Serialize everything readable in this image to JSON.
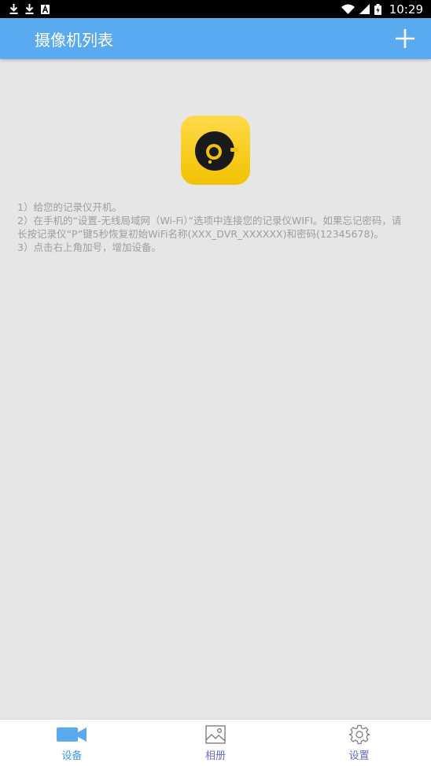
{
  "status_bar": {
    "time": "10:29",
    "icons": [
      "download-icon",
      "download-icon",
      "notification-a-icon",
      "wifi-icon",
      "signal-icon",
      "battery-icon"
    ]
  },
  "app_bar": {
    "title": "摄像机列表",
    "add_icon": "plus-icon"
  },
  "content": {
    "logo_icon": "camera-lens-logo",
    "instructions": [
      "1）给您的记录仪开机。",
      "2）在手机的“设置-无线局域网（Wi-Fi）”选项中连接您的记录仪WIFI。如果忘记密码，请长按记录仪“P”键5秒恢复初始WiFi名称(XXX_DVR_XXXXXX)和密码(12345678)。",
      "3）点击右上角加号，增加设备。"
    ]
  },
  "tabs": [
    {
      "label": "设备",
      "icon": "video-camera-icon",
      "active": true
    },
    {
      "label": "相册",
      "icon": "image-icon",
      "active": false
    },
    {
      "label": "设置",
      "icon": "gear-icon",
      "active": false
    }
  ],
  "colors": {
    "app_bar": "#5aaaf0",
    "active_tab": "#3a9ae8",
    "inactive_tab": "#6a6ac8",
    "logo": "#f2c200"
  }
}
